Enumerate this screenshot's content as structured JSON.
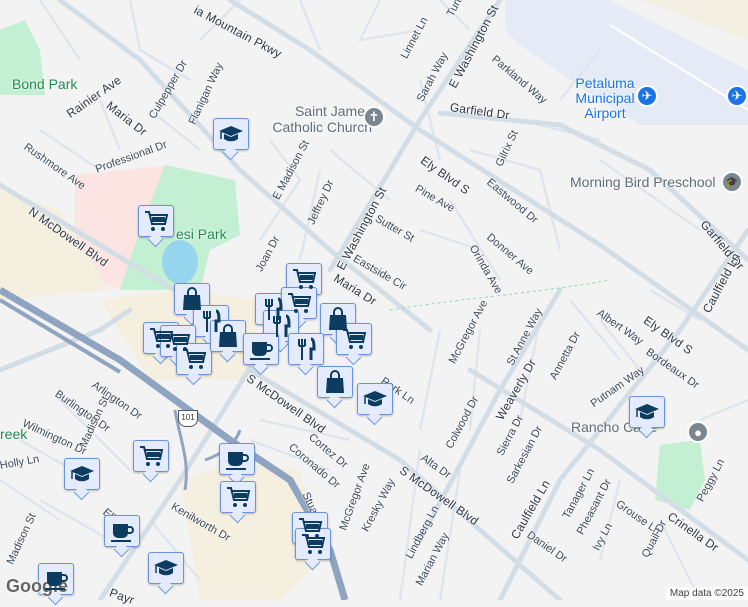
{
  "map": {
    "attribution": "Map data ©2025",
    "logo": "Google",
    "highway_shield": "101",
    "colors": {
      "road": "#d3dde6",
      "highway": "#8ea4c0",
      "park": "#c3efd3",
      "airport": "#e4ebf7",
      "commercial": "#f5efdf",
      "marker_fill": "#e3ebfc",
      "marker_border": "#6b94d8",
      "marker_icon": "#0d3c61"
    }
  },
  "places": {
    "bond_park": "Bond Park",
    "lucchesi_park": "esi Park",
    "church": "Saint James Catholic Church",
    "airport": "Petaluma Municipal Airport",
    "preschool": "Morning Bird Preschool",
    "rancho": "Rancho Ca    re",
    "creek": "reek"
  },
  "streets": [
    "ia Mountain Pkwy",
    "Rainier Ave",
    "Maria Dr",
    "Culpepper Dr",
    "Flanigan Way",
    "Rushmore Ave",
    "Professional Dr",
    "N McDowell Blvd",
    "E Madison St",
    "Jeffrey Dr",
    "Joan Dr",
    "E Washington St",
    "E Washington St",
    "Sarah Way",
    "Linnet Ln",
    "Parkland Way",
    "Garfield Dr",
    "Gilrix St",
    "Ely Blvd S",
    "Pine Ave",
    "Eastwood Dr",
    "Sutter St",
    "Donner Ave",
    "Orinda Ave",
    "Eastside Cir",
    "Maria Dr",
    "Garfield Dr",
    "Caulfield Ln",
    "Bordeaux Dr",
    "Albert Way",
    "Ely Blvd S",
    "McGregor Ave",
    "St Anne Way",
    "Annetta Dr",
    "Putnam Way",
    "Weaverly Dr",
    "Park Ln",
    "Colwood Dr",
    "Sierra Dr",
    "Sarkesian Dr",
    "Alta Dr",
    "S McDowell Blvd",
    "S McDowell Blvd",
    "Caulfield Ln",
    "Tanager Ln",
    "Pheasant Dr",
    "Grouse Ln",
    "Ivy Ln",
    "Quail Dr",
    "Daniel Dr",
    "Crinella Dr",
    "Peggy Ln",
    "Lindberg Ln",
    "Marian Way",
    "Kresky Way",
    "McGregor Ave",
    "Arlington Dr",
    "Burlington Dr",
    "Wilmington Dr",
    "Madison St",
    "Holly Ln",
    "Ellis St",
    "Kenilworth Dr",
    "Cortez Dr",
    "Coronado Dr",
    "Stuart Dr",
    "Madison St",
    "Turtle C",
    "Payr"
  ],
  "markers": [
    {
      "icon": "school-icon"
    },
    {
      "icon": "shopping-cart-icon"
    },
    {
      "icon": "shopping-cart-icon"
    },
    {
      "icon": "shopping-bag-icon"
    },
    {
      "icon": "utensils-icon"
    },
    {
      "icon": "shopping-cart-icon"
    },
    {
      "icon": "shopping-cart-icon"
    },
    {
      "icon": "shopping-cart-icon"
    },
    {
      "icon": "shopping-bag-icon"
    },
    {
      "icon": "utensils-icon"
    },
    {
      "icon": "shopping-cart-icon"
    },
    {
      "icon": "utensils-icon"
    },
    {
      "icon": "coffee-icon"
    },
    {
      "icon": "shopping-bag-icon"
    },
    {
      "icon": "shopping-cart-icon"
    },
    {
      "icon": "utensils-icon"
    },
    {
      "icon": "shopping-bag-icon"
    },
    {
      "icon": "school-icon"
    },
    {
      "icon": "shopping-cart-icon"
    },
    {
      "icon": "school-icon"
    },
    {
      "icon": "coffee-icon"
    },
    {
      "icon": "shopping-cart-icon"
    },
    {
      "icon": "shopping-cart-icon"
    },
    {
      "icon": "shopping-cart-icon"
    },
    {
      "icon": "coffee-icon"
    },
    {
      "icon": "school-icon"
    },
    {
      "icon": "coffee-icon"
    },
    {
      "icon": "school-icon"
    }
  ]
}
